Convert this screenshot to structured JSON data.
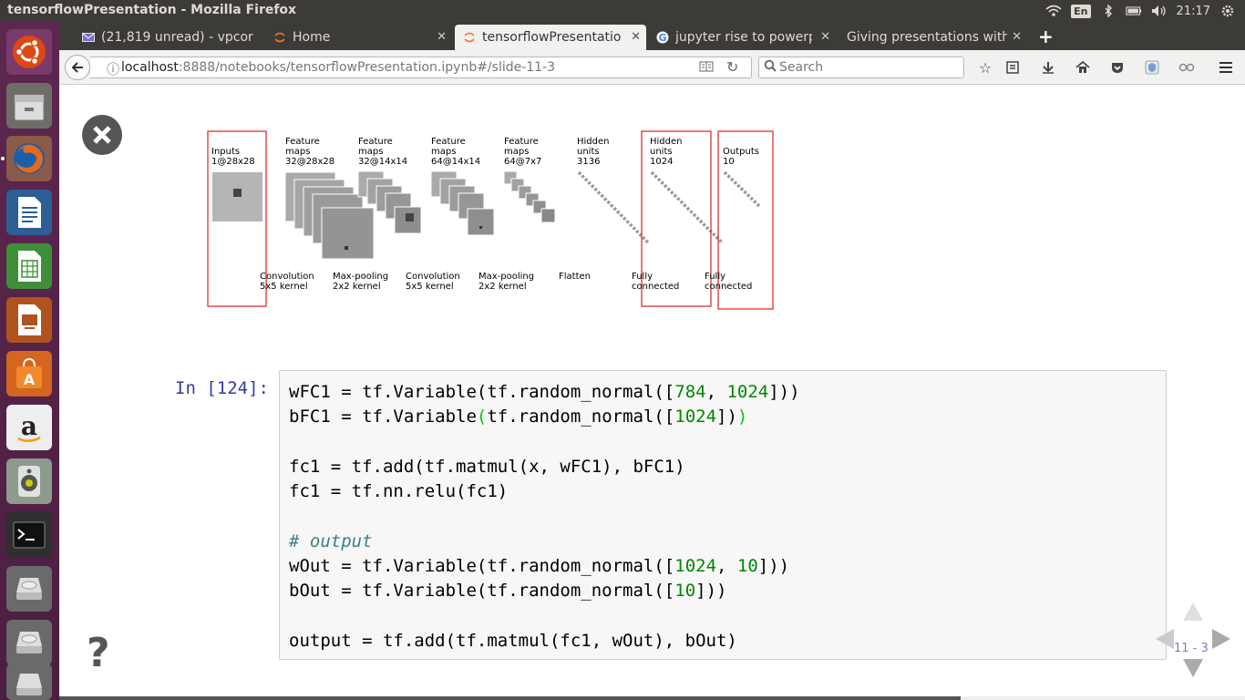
{
  "window": {
    "title": "tensorflowPresentation - Mozilla Firefox"
  },
  "tray": {
    "keyboard": "En",
    "time": "21:17"
  },
  "tabs": [
    {
      "label": "(21,819 unread) - vpcor",
      "icon": "mail-icon"
    },
    {
      "label": "Home",
      "icon": "jupyter-icon"
    },
    {
      "label": "tensorflowPresentatio",
      "icon": "jupyter-icon",
      "active": true
    },
    {
      "label": "jupyter rise to powerp",
      "icon": "google-icon"
    },
    {
      "label": "Giving presentations with",
      "icon": "none"
    }
  ],
  "nav": {
    "url_host": "localhost",
    "url_rest": ":8888/notebooks/tensorflowPresentation.ipynb#/slide-11-3",
    "search_placeholder": "Search"
  },
  "diagram": {
    "layers": [
      {
        "title": "Inputs",
        "dims": "1@28x28"
      },
      {
        "title": "Feature\nmaps",
        "dims": "32@28x28"
      },
      {
        "title": "Feature\nmaps",
        "dims": "32@14x14"
      },
      {
        "title": "Feature\nmaps",
        "dims": "64@14x14"
      },
      {
        "title": "Feature\nmaps",
        "dims": "64@7x7"
      },
      {
        "title": "Hidden\nunits",
        "dims": "3136"
      },
      {
        "title": "Hidden\nunits",
        "dims": "1024"
      },
      {
        "title": "Outputs",
        "dims": "10"
      }
    ],
    "ops": [
      "Convolution\n5x5 kernel",
      "Max-pooling\n2x2 kernel",
      "Convolution\n5x5 kernel",
      "Max-pooling\n2x2 kernel",
      "Flatten",
      "Fully\nconnected",
      "Fully\nconnected"
    ]
  },
  "cell": {
    "prompt": "In [124]:",
    "lines": [
      [
        [
          "t",
          "wFC1 = tf.Variable(tf.random_normal(["
        ],
        [
          "n",
          "784"
        ],
        [
          "t",
          ", "
        ],
        [
          "n",
          "1024"
        ],
        [
          "t",
          "]))"
        ]
      ],
      [
        [
          "t",
          "bFC1 = tf.Variable"
        ],
        [
          "m",
          "("
        ],
        [
          "t",
          "tf.random_normal(["
        ],
        [
          "n",
          "1024"
        ],
        [
          "t",
          "])"
        ],
        [
          "m",
          ")"
        ]
      ],
      [],
      [
        [
          "t",
          "fc1 = tf.add(tf.matmul(x, wFC1), bFC1)"
        ]
      ],
      [
        [
          "t",
          "fc1 = tf.nn.relu(fc1)"
        ]
      ],
      [],
      [
        [
          "c",
          "# output"
        ]
      ],
      [
        [
          "t",
          "wOut = tf.Variable(tf.random_normal(["
        ],
        [
          "n",
          "1024"
        ],
        [
          "t",
          ", "
        ],
        [
          "n",
          "10"
        ],
        [
          "t",
          "]))"
        ]
      ],
      [
        [
          "t",
          "bOut = tf.Variable(tf.random_normal(["
        ],
        [
          "n",
          "10"
        ],
        [
          "t",
          "]))"
        ]
      ],
      [],
      [
        [
          "t",
          "output = tf.add(tf.matmul(fc1, wOut), bOut)"
        ]
      ]
    ]
  },
  "slide": {
    "number": "11 - 3",
    "progress": 0.76
  }
}
